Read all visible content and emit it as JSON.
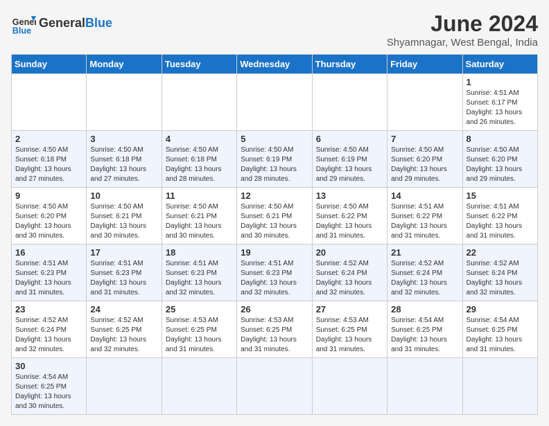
{
  "logo": {
    "text_general": "General",
    "text_blue": "Blue"
  },
  "title": "June 2024",
  "subtitle": "Shyamnagar, West Bengal, India",
  "days_of_week": [
    "Sunday",
    "Monday",
    "Tuesday",
    "Wednesday",
    "Thursday",
    "Friday",
    "Saturday"
  ],
  "weeks": [
    [
      {
        "day": "",
        "info": ""
      },
      {
        "day": "",
        "info": ""
      },
      {
        "day": "",
        "info": ""
      },
      {
        "day": "",
        "info": ""
      },
      {
        "day": "",
        "info": ""
      },
      {
        "day": "",
        "info": ""
      },
      {
        "day": "1",
        "info": "Sunrise: 4:51 AM\nSunset: 6:17 PM\nDaylight: 13 hours and 26 minutes."
      }
    ],
    [
      {
        "day": "2",
        "info": "Sunrise: 4:50 AM\nSunset: 6:18 PM\nDaylight: 13 hours and 27 minutes."
      },
      {
        "day": "3",
        "info": "Sunrise: 4:50 AM\nSunset: 6:18 PM\nDaylight: 13 hours and 27 minutes."
      },
      {
        "day": "4",
        "info": "Sunrise: 4:50 AM\nSunset: 6:18 PM\nDaylight: 13 hours and 28 minutes."
      },
      {
        "day": "5",
        "info": "Sunrise: 4:50 AM\nSunset: 6:19 PM\nDaylight: 13 hours and 28 minutes."
      },
      {
        "day": "6",
        "info": "Sunrise: 4:50 AM\nSunset: 6:19 PM\nDaylight: 13 hours and 29 minutes."
      },
      {
        "day": "7",
        "info": "Sunrise: 4:50 AM\nSunset: 6:20 PM\nDaylight: 13 hours and 29 minutes."
      },
      {
        "day": "8",
        "info": "Sunrise: 4:50 AM\nSunset: 6:20 PM\nDaylight: 13 hours and 29 minutes."
      }
    ],
    [
      {
        "day": "9",
        "info": "Sunrise: 4:50 AM\nSunset: 6:20 PM\nDaylight: 13 hours and 30 minutes."
      },
      {
        "day": "10",
        "info": "Sunrise: 4:50 AM\nSunset: 6:21 PM\nDaylight: 13 hours and 30 minutes."
      },
      {
        "day": "11",
        "info": "Sunrise: 4:50 AM\nSunset: 6:21 PM\nDaylight: 13 hours and 30 minutes."
      },
      {
        "day": "12",
        "info": "Sunrise: 4:50 AM\nSunset: 6:21 PM\nDaylight: 13 hours and 30 minutes."
      },
      {
        "day": "13",
        "info": "Sunrise: 4:50 AM\nSunset: 6:22 PM\nDaylight: 13 hours and 31 minutes."
      },
      {
        "day": "14",
        "info": "Sunrise: 4:51 AM\nSunset: 6:22 PM\nDaylight: 13 hours and 31 minutes."
      },
      {
        "day": "15",
        "info": "Sunrise: 4:51 AM\nSunset: 6:22 PM\nDaylight: 13 hours and 31 minutes."
      }
    ],
    [
      {
        "day": "16",
        "info": "Sunrise: 4:51 AM\nSunset: 6:23 PM\nDaylight: 13 hours and 31 minutes."
      },
      {
        "day": "17",
        "info": "Sunrise: 4:51 AM\nSunset: 6:23 PM\nDaylight: 13 hours and 31 minutes."
      },
      {
        "day": "18",
        "info": "Sunrise: 4:51 AM\nSunset: 6:23 PM\nDaylight: 13 hours and 32 minutes."
      },
      {
        "day": "19",
        "info": "Sunrise: 4:51 AM\nSunset: 6:23 PM\nDaylight: 13 hours and 32 minutes."
      },
      {
        "day": "20",
        "info": "Sunrise: 4:52 AM\nSunset: 6:24 PM\nDaylight: 13 hours and 32 minutes."
      },
      {
        "day": "21",
        "info": "Sunrise: 4:52 AM\nSunset: 6:24 PM\nDaylight: 13 hours and 32 minutes."
      },
      {
        "day": "22",
        "info": "Sunrise: 4:52 AM\nSunset: 6:24 PM\nDaylight: 13 hours and 32 minutes."
      }
    ],
    [
      {
        "day": "23",
        "info": "Sunrise: 4:52 AM\nSunset: 6:24 PM\nDaylight: 13 hours and 32 minutes."
      },
      {
        "day": "24",
        "info": "Sunrise: 4:52 AM\nSunset: 6:25 PM\nDaylight: 13 hours and 32 minutes."
      },
      {
        "day": "25",
        "info": "Sunrise: 4:53 AM\nSunset: 6:25 PM\nDaylight: 13 hours and 31 minutes."
      },
      {
        "day": "26",
        "info": "Sunrise: 4:53 AM\nSunset: 6:25 PM\nDaylight: 13 hours and 31 minutes."
      },
      {
        "day": "27",
        "info": "Sunrise: 4:53 AM\nSunset: 6:25 PM\nDaylight: 13 hours and 31 minutes."
      },
      {
        "day": "28",
        "info": "Sunrise: 4:54 AM\nSunset: 6:25 PM\nDaylight: 13 hours and 31 minutes."
      },
      {
        "day": "29",
        "info": "Sunrise: 4:54 AM\nSunset: 6:25 PM\nDaylight: 13 hours and 31 minutes."
      }
    ],
    [
      {
        "day": "30",
        "info": "Sunrise: 4:54 AM\nSunset: 6:25 PM\nDaylight: 13 hours and 30 minutes."
      },
      {
        "day": "",
        "info": ""
      },
      {
        "day": "",
        "info": ""
      },
      {
        "day": "",
        "info": ""
      },
      {
        "day": "",
        "info": ""
      },
      {
        "day": "",
        "info": ""
      },
      {
        "day": "",
        "info": ""
      }
    ]
  ]
}
